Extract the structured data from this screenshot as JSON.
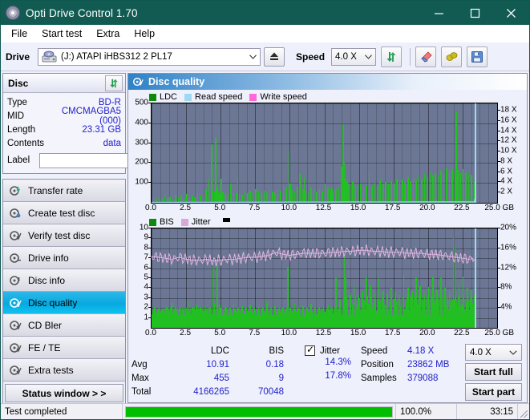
{
  "window": {
    "title": "Opti Drive Control 1.70",
    "icon": "disc-icon",
    "minimize": "minimize-icon",
    "maximize": "maximize-icon",
    "close": "close-icon"
  },
  "menu": {
    "items": [
      "File",
      "Start test",
      "Extra",
      "Help"
    ]
  },
  "toolbar": {
    "drive_label": "Drive",
    "drive_value": "(J:)   ATAPI iHBS312   2 PL17",
    "eject_icon": "eject-icon",
    "speed_label": "Speed",
    "speed_value": "4.0 X",
    "refresh_icon": "refresh-icon",
    "eraser_icon": "eraser-icon",
    "bulb_icon": "bulb-icon",
    "save_icon": "save-icon"
  },
  "disc": {
    "title": "Disc",
    "refresh_icon": "refresh-icon",
    "rows": [
      {
        "key": "Type",
        "value": "BD-R"
      },
      {
        "key": "MID",
        "value": "CMCMAGBA5 (000)"
      },
      {
        "key": "Length",
        "value": "23.31 GB"
      },
      {
        "key": "Contents",
        "value": "data"
      }
    ],
    "label_key": "Label",
    "label_value": "",
    "cd_icon": "cd-icon"
  },
  "nav": {
    "items": [
      {
        "label": "Transfer rate",
        "icon": "disc-arrow-icon",
        "active": false
      },
      {
        "label": "Create test disc",
        "icon": "disc-write-icon",
        "active": false
      },
      {
        "label": "Verify test disc",
        "icon": "disc-check-icon",
        "active": false
      },
      {
        "label": "Drive info",
        "icon": "drive-info-icon",
        "active": false
      },
      {
        "label": "Disc info",
        "icon": "disc-info-icon",
        "active": false
      },
      {
        "label": "Disc quality",
        "icon": "disc-quality-icon",
        "active": true
      },
      {
        "label": "CD Bler",
        "icon": "disc-bler-icon",
        "active": false
      },
      {
        "label": "FE / TE",
        "icon": "disc-fete-icon",
        "active": false
      },
      {
        "label": "Extra tests",
        "icon": "disc-extra-icon",
        "active": false
      }
    ],
    "status_button": "Status window > >"
  },
  "panel": {
    "title": "Disc quality",
    "icon": "disc-quality-icon"
  },
  "stats": {
    "headers": {
      "ldc": "LDC",
      "bis": "BIS",
      "jitter": "Jitter"
    },
    "rows": [
      {
        "key": "Avg",
        "ldc": "10.91",
        "bis": "0.18",
        "jitter": "14.3%"
      },
      {
        "key": "Max",
        "ldc": "455",
        "bis": "9",
        "jitter": "17.8%"
      },
      {
        "key": "Total",
        "ldc": "4166265",
        "bis": "70048",
        "jitter": ""
      }
    ],
    "jitter_checked": true,
    "right": [
      {
        "key": "Speed",
        "value": "4.18 X"
      },
      {
        "key": "Position",
        "value": "23862 MB"
      },
      {
        "key": "Samples",
        "value": "379088"
      }
    ],
    "speed_select": "4.0 X",
    "start_full": "Start full",
    "start_part": "Start part"
  },
  "statusbar": {
    "text": "Test completed",
    "percent": "100.0%",
    "progress": 100,
    "time": "33:15"
  },
  "chart_data": [
    {
      "type": "line",
      "name": "top-chart",
      "title": "",
      "xlabel": "GB",
      "ylabel": "LDC",
      "xlim": [
        0,
        25.0
      ],
      "xticks": [
        0.0,
        2.5,
        5.0,
        7.5,
        10.0,
        12.5,
        15.0,
        17.5,
        20.0,
        22.5,
        25.0
      ],
      "xticklabels": [
        "0.0",
        "2.5",
        "5.0",
        "7.5",
        "10.0",
        "12.5",
        "15.0",
        "17.5",
        "20.0",
        "22.5",
        "25.0 GB"
      ],
      "ylim": [
        0,
        500
      ],
      "yticks": [
        100,
        200,
        300,
        400,
        500
      ],
      "yticklabels": [
        "100",
        "200",
        "300",
        "400",
        "500"
      ],
      "y2lim": [
        0,
        19.44
      ],
      "y2ticks": [
        2,
        4,
        6,
        8,
        10,
        12,
        14,
        16,
        18
      ],
      "y2ticklabels": [
        "2 X",
        "4 X",
        "6 X",
        "8 X",
        "10 X",
        "12 X",
        "14 X",
        "16 X",
        "18 X"
      ],
      "grid": true,
      "legend": [
        {
          "label": "LDC",
          "color": "#0b8a0b"
        },
        {
          "label": "Read speed",
          "color": "#9fd8f2"
        },
        {
          "label": "Write speed",
          "color": "#ff66d9"
        }
      ],
      "legend_position": "top-left",
      "series": [
        {
          "name": "LDC",
          "color": "#22c022",
          "kind": "impulse",
          "x": [
            0.1,
            0.3,
            0.5,
            0.7,
            0.9,
            1.1,
            1.3,
            1.5,
            1.7,
            1.9,
            2.1,
            2.3,
            2.5,
            2.7,
            2.9,
            3.1,
            3.3,
            3.5,
            3.7,
            3.9,
            4.1,
            4.3,
            4.4,
            4.5,
            4.6,
            4.7,
            4.8,
            4.9,
            5.0,
            5.1,
            5.3,
            5.5,
            5.7,
            5.9,
            6.1,
            6.2,
            6.3,
            6.5,
            6.7,
            6.9,
            7.1,
            7.3,
            7.5,
            7.7,
            7.9,
            8.1,
            8.3,
            8.5,
            8.7,
            8.9,
            9.1,
            9.3,
            9.5,
            9.7,
            9.9,
            10.0,
            10.1,
            10.3,
            10.5,
            10.7,
            10.9,
            11.0,
            11.1,
            11.3,
            11.5,
            11.7,
            11.9,
            12.1,
            12.3,
            12.5,
            12.7,
            12.9,
            13.0,
            13.1,
            13.3,
            13.5,
            13.7,
            13.8,
            13.9,
            14.0,
            14.1,
            14.2,
            14.3,
            14.5,
            14.7,
            14.9,
            15.1,
            15.3,
            15.5,
            15.7,
            15.9,
            16.1,
            16.3,
            16.5,
            16.7,
            16.9,
            17.1,
            17.3,
            17.5,
            17.7,
            17.9,
            18.1,
            18.3,
            18.5,
            18.7,
            18.9,
            19.1,
            19.3,
            19.5,
            19.7,
            19.9,
            20.1,
            20.3,
            20.5,
            20.7,
            20.9,
            21.1,
            21.3,
            21.5,
            21.7,
            21.9,
            22.0,
            22.1,
            22.3,
            22.5,
            22.7,
            22.9,
            23.1,
            23.3
          ],
          "y": [
            30,
            22,
            28,
            20,
            35,
            25,
            30,
            22,
            40,
            28,
            35,
            25,
            45,
            30,
            38,
            28,
            50,
            35,
            42,
            70,
            120,
            295,
            60,
            55,
            330,
            75,
            60,
            50,
            120,
            55,
            45,
            40,
            95,
            60,
            50,
            130,
            45,
            40,
            55,
            48,
            60,
            50,
            70,
            55,
            48,
            60,
            52,
            45,
            58,
            50,
            70,
            60,
            90,
            75,
            260,
            95,
            65,
            55,
            80,
            150,
            70,
            130,
            60,
            50,
            75,
            65,
            55,
            70,
            60,
            95,
            80,
            65,
            75,
            60,
            70,
            80,
            180,
            395,
            200,
            120,
            110,
            95,
            85,
            110,
            90,
            85,
            95,
            80,
            90,
            155,
            85,
            100,
            90,
            115,
            95,
            105,
            95,
            110,
            100,
            120,
            105,
            115,
            100,
            130,
            110,
            125,
            115,
            135,
            120,
            145,
            130,
            155,
            140,
            150,
            135,
            160,
            145,
            175,
            160,
            170,
            155,
            455,
            165,
            150,
            170,
            155,
            145,
            140,
            110
          ]
        },
        {
          "name": "Read speed",
          "color": "#9fd8f2",
          "kind": "line",
          "x": [
            0.0,
            1.0,
            2.0,
            3.0,
            4.0,
            5.0,
            6.0,
            7.0,
            8.0,
            9.0,
            10.0,
            11.0,
            12.0,
            13.0,
            14.0,
            15.0,
            16.0,
            17.0,
            18.0,
            19.0,
            20.0,
            21.0,
            22.0,
            23.0,
            23.35,
            23.4
          ],
          "y": [
            1.7,
            1.8,
            2.0,
            2.1,
            2.25,
            2.4,
            2.6,
            2.75,
            2.9,
            3.0,
            3.1,
            3.2,
            3.25,
            3.3,
            3.45,
            3.6,
            3.7,
            3.75,
            3.8,
            3.9,
            4.1,
            4.15,
            4.2,
            4.2,
            4.2,
            18.8
          ]
        },
        {
          "name": "Write speed",
          "color": "#ff66d9",
          "kind": "line",
          "x": [],
          "y": []
        }
      ]
    },
    {
      "type": "line",
      "name": "bottom-chart",
      "title": "",
      "xlabel": "GB",
      "ylabel": "BIS",
      "xlim": [
        0,
        25.0
      ],
      "xticks": [
        0.0,
        2.5,
        5.0,
        7.5,
        10.0,
        12.5,
        15.0,
        17.5,
        20.0,
        22.5,
        25.0
      ],
      "xticklabels": [
        "0.0",
        "2.5",
        "5.0",
        "7.5",
        "10.0",
        "12.5",
        "15.0",
        "17.5",
        "20.0",
        "22.5",
        "25.0 GB"
      ],
      "ylim": [
        0,
        10
      ],
      "yticks": [
        1,
        2,
        3,
        4,
        5,
        6,
        7,
        8,
        9,
        10
      ],
      "yticklabels": [
        "1",
        "2",
        "3",
        "4",
        "5",
        "6",
        "7",
        "8",
        "9",
        "10"
      ],
      "y2lim": [
        0,
        20
      ],
      "y2ticks": [
        4,
        8,
        12,
        16,
        20
      ],
      "y2ticklabels": [
        "4%",
        "8%",
        "12%",
        "16%",
        "20%"
      ],
      "grid": true,
      "legend": [
        {
          "label": "BIS",
          "color": "#0b8a0b"
        },
        {
          "label": "Jitter",
          "color": "#d9a8d9"
        }
      ],
      "legend_position": "top-left",
      "series": [
        {
          "name": "BIS",
          "color": "#22c022",
          "kind": "impulse",
          "baseline": 1.3,
          "x": [
            0.2,
            0.5,
            0.8,
            1.1,
            1.4,
            1.7,
            2.0,
            2.3,
            2.6,
            2.9,
            3.2,
            3.5,
            3.8,
            4.1,
            4.4,
            4.5,
            4.7,
            4.9,
            5.0,
            5.3,
            5.6,
            5.9,
            6.2,
            6.5,
            6.8,
            7.1,
            7.4,
            7.7,
            8.0,
            8.3,
            8.6,
            8.9,
            9.2,
            9.5,
            9.8,
            10.0,
            10.3,
            10.6,
            10.9,
            11.2,
            11.5,
            11.8,
            12.1,
            12.4,
            12.7,
            13.0,
            13.3,
            13.6,
            13.9,
            14.0,
            14.3,
            14.6,
            14.9,
            15.2,
            15.5,
            15.8,
            16.1,
            16.4,
            16.7,
            17.0,
            17.3,
            17.6,
            17.9,
            18.2,
            18.5,
            18.8,
            19.1,
            19.4,
            19.7,
            20.0,
            20.3,
            20.6,
            20.9,
            21.2,
            21.5,
            21.8,
            21.9,
            22.2,
            22.5,
            22.8,
            23.1,
            23.3
          ],
          "y": [
            2.0,
            2.0,
            1.9,
            2.0,
            2.5,
            2.0,
            2.1,
            2.0,
            2.6,
            2.0,
            2.3,
            2.0,
            2.2,
            2.0,
            6.1,
            2.5,
            6.4,
            2.3,
            2.0,
            2.1,
            2.0,
            2.4,
            2.0,
            2.2,
            2.0,
            2.3,
            2.0,
            2.1,
            2.0,
            2.6,
            2.0,
            2.2,
            2.0,
            2.1,
            6.1,
            2.0,
            2.5,
            2.0,
            2.2,
            2.0,
            2.4,
            2.0,
            2.1,
            2.0,
            2.3,
            2.0,
            5.0,
            2.8,
            7.0,
            5.0,
            3.5,
            4.2,
            3.3,
            3.6,
            5.0,
            4.3,
            3.4,
            5.0,
            3.7,
            3.5,
            4.0,
            3.6,
            3.3,
            5.5,
            4.0,
            3.7,
            5.0,
            4.2,
            3.5,
            4.1,
            5.2,
            3.8,
            5.0,
            4.0,
            3.6,
            9.0,
            8.2,
            4.2,
            5.2,
            4.0,
            3.8,
            3.3
          ]
        },
        {
          "name": "Jitter",
          "color": "#e0b4e0",
          "kind": "line",
          "x": [
            0.0,
            0.5,
            1.0,
            1.5,
            2.0,
            2.5,
            3.0,
            3.5,
            4.0,
            4.5,
            5.0,
            5.5,
            6.0,
            6.5,
            7.0,
            7.5,
            8.0,
            8.5,
            9.0,
            9.5,
            10.0,
            10.5,
            11.0,
            11.5,
            12.0,
            12.5,
            13.0,
            13.5,
            14.0,
            14.5,
            15.0,
            15.5,
            16.0,
            16.5,
            17.0,
            17.5,
            18.0,
            18.5,
            19.0,
            19.5,
            20.0,
            20.5,
            21.0,
            21.5,
            22.0,
            22.5,
            23.0,
            23.3
          ],
          "y": [
            7.2,
            7.1,
            7.0,
            6.9,
            7.1,
            6.9,
            6.8,
            6.8,
            6.9,
            6.7,
            6.8,
            6.9,
            6.9,
            7.0,
            7.1,
            7.1,
            7.2,
            7.3,
            7.6,
            7.4,
            7.3,
            7.4,
            7.5,
            7.5,
            7.5,
            7.5,
            7.6,
            7.6,
            7.7,
            7.7,
            7.8,
            7.8,
            7.7,
            7.7,
            7.6,
            7.6,
            7.6,
            7.5,
            7.5,
            7.5,
            7.4,
            7.4,
            7.3,
            7.2,
            7.1,
            7.0,
            6.9,
            7.0
          ]
        }
      ]
    }
  ]
}
